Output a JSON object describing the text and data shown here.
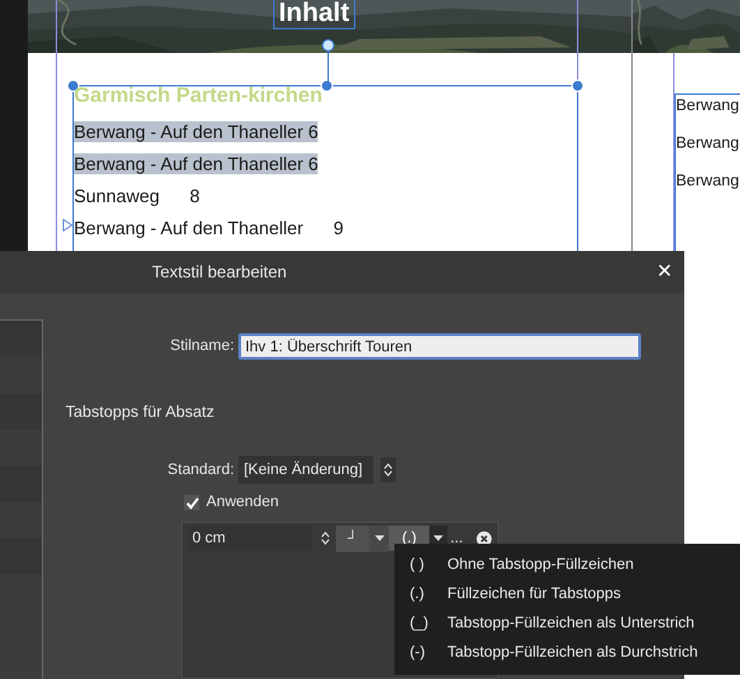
{
  "document": {
    "frame_title": "Inhalt",
    "heading": "Garmisch Parten-kirchen",
    "lines": [
      {
        "text": "Berwang - Auf den Thaneller",
        "number": "6",
        "selected": true
      },
      {
        "text": "Berwang - Auf den Thaneller",
        "number": "6",
        "selected": true
      },
      {
        "text": "Sunnaweg",
        "number": "8",
        "selected": false
      },
      {
        "text": "Berwang - Auf den Thaneller",
        "number": "9",
        "selected": false
      }
    ]
  },
  "next_page": {
    "lines": [
      "Berwang",
      "Berwang",
      "Berwang"
    ]
  },
  "dialog": {
    "title": "Textstil bearbeiten",
    "close": "✕",
    "style_name": {
      "label": "Stilname:",
      "value": "Ihv 1: Überschrift Touren"
    },
    "section": "Tabstopps für Absatz",
    "standard": {
      "label": "Standard:",
      "value": "[Keine Änderung]"
    },
    "apply": {
      "label": "Anwenden",
      "checked": true
    },
    "tab_stop": {
      "position": "0 cm",
      "alignment": "┘",
      "leader": "(.)",
      "more": "..."
    },
    "leader_menu": [
      {
        "glyph": "( )",
        "label": "Ohne Tabstopp-Füllzeichen"
      },
      {
        "glyph": "(.)",
        "label": "Füllzeichen für Tabstopps"
      },
      {
        "glyph": "(_)",
        "label": "Tabstopp-Füllzeichen als Unterstrich"
      },
      {
        "glyph": "(-)",
        "label": "Tabstopp-Füllzeichen als Durchstrich"
      }
    ]
  }
}
